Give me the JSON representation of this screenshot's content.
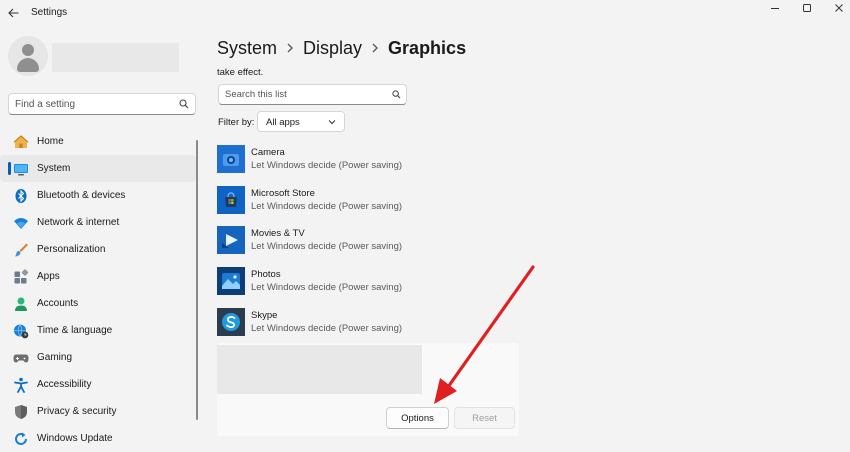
{
  "window": {
    "title": "Settings",
    "back_icon": "back-arrow-icon",
    "controls": [
      "minimize-icon",
      "maximize-icon",
      "close-icon"
    ]
  },
  "sidebar": {
    "search_placeholder": "Find a setting",
    "items": [
      {
        "label": "Home",
        "icon": "home-icon",
        "color": "#e8a33d"
      },
      {
        "label": "System",
        "icon": "system-icon",
        "color": "#0078d4",
        "active": true
      },
      {
        "label": "Bluetooth & devices",
        "icon": "bluetooth-icon",
        "color": "#0078d4"
      },
      {
        "label": "Network & internet",
        "icon": "wifi-icon",
        "color": "#0078d4"
      },
      {
        "label": "Personalization",
        "icon": "brush-icon",
        "color": "#d87532"
      },
      {
        "label": "Apps",
        "icon": "apps-icon",
        "color": "#5c6b7a"
      },
      {
        "label": "Accounts",
        "icon": "person-icon",
        "color": "#2bb673"
      },
      {
        "label": "Time & language",
        "icon": "globe-clock-icon",
        "color": "#0078d4"
      },
      {
        "label": "Gaming",
        "icon": "gamepad-icon",
        "color": "#6b6b6b"
      },
      {
        "label": "Accessibility",
        "icon": "accessibility-icon",
        "color": "#0078d4"
      },
      {
        "label": "Privacy & security",
        "icon": "shield-icon",
        "color": "#6b6b6b"
      },
      {
        "label": "Windows Update",
        "icon": "update-icon",
        "color": "#0078d4"
      }
    ]
  },
  "breadcrumb": {
    "items": [
      "System",
      "Display"
    ],
    "current": "Graphics"
  },
  "main": {
    "truncated_text": "take effect.",
    "search_placeholder": "Search this list",
    "filter_label": "Filter by:",
    "filter_value": "All apps",
    "apps": [
      {
        "name": "Camera",
        "preference": "Let Windows decide (Power saving)",
        "icon": "camera-app-icon"
      },
      {
        "name": "Microsoft Store",
        "preference": "Let Windows decide (Power saving)",
        "icon": "store-app-icon"
      },
      {
        "name": "Movies & TV",
        "preference": "Let Windows decide (Power saving)",
        "icon": "movies-app-icon"
      },
      {
        "name": "Photos",
        "preference": "Let Windows decide (Power saving)",
        "icon": "photos-app-icon"
      },
      {
        "name": "Skype",
        "preference": "Let Windows decide (Power saving)",
        "icon": "skype-app-icon"
      }
    ],
    "options_button": "Options",
    "reset_button": "Reset"
  },
  "colors": {
    "accent": "#005fb8",
    "annotation_arrow": "#e02020",
    "background": "#f3f3f3"
  }
}
